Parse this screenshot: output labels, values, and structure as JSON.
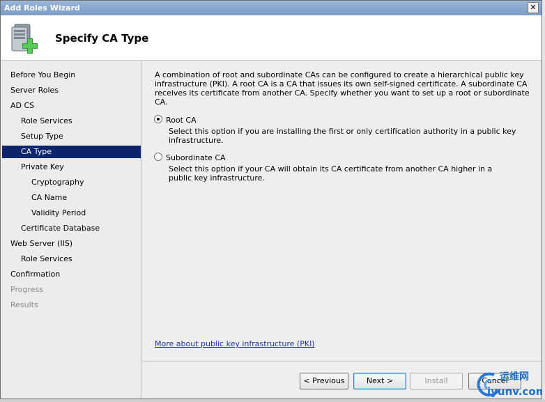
{
  "window": {
    "title": "Add Roles Wizard",
    "close_glyph": "✕"
  },
  "header": {
    "title": "Specify CA Type",
    "icon": "server-add-icon"
  },
  "sidebar": {
    "items": [
      {
        "label": "Before You Begin",
        "level": 0,
        "state": "normal"
      },
      {
        "label": "Server Roles",
        "level": 0,
        "state": "normal"
      },
      {
        "label": "AD CS",
        "level": 0,
        "state": "normal"
      },
      {
        "label": "Role Services",
        "level": 1,
        "state": "normal"
      },
      {
        "label": "Setup Type",
        "level": 1,
        "state": "normal"
      },
      {
        "label": "CA Type",
        "level": 1,
        "state": "selected"
      },
      {
        "label": "Private Key",
        "level": 1,
        "state": "normal"
      },
      {
        "label": "Cryptography",
        "level": 2,
        "state": "normal"
      },
      {
        "label": "CA Name",
        "level": 2,
        "state": "normal"
      },
      {
        "label": "Validity Period",
        "level": 2,
        "state": "normal"
      },
      {
        "label": "Certificate Database",
        "level": 1,
        "state": "normal"
      },
      {
        "label": "Web Server (IIS)",
        "level": 0,
        "state": "normal"
      },
      {
        "label": "Role Services",
        "level": 1,
        "state": "normal"
      },
      {
        "label": "Confirmation",
        "level": 0,
        "state": "normal"
      },
      {
        "label": "Progress",
        "level": 0,
        "state": "disabled"
      },
      {
        "label": "Results",
        "level": 0,
        "state": "disabled"
      }
    ]
  },
  "main": {
    "description": "A combination of root and subordinate CAs can be configured to create a hierarchical public key infrastructure (PKI). A root CA is a CA that issues its own self-signed certificate. A subordinate CA receives its certificate from another CA. Specify whether you want to set up a root or subordinate CA.",
    "options": [
      {
        "label": "Root CA",
        "help": "Select this option if you are installing the first or only certification authority in a public key infrastructure.",
        "checked": true
      },
      {
        "label": "Subordinate CA",
        "help": "Select this option if your CA will obtain its CA certificate from another CA higher in a public key infrastructure.",
        "checked": false
      }
    ],
    "more_link": "More about public key infrastructure (PKI)"
  },
  "buttons": {
    "previous": "< Previous",
    "next": "Next >",
    "install": "Install",
    "cancel": "Cancel"
  },
  "watermark": {
    "cn": "运维网",
    "domain": "iyunv.com"
  },
  "colors": {
    "selected_bg": "#0c246b",
    "link": "#1a33a6",
    "titlebar": "#88a8cf"
  }
}
